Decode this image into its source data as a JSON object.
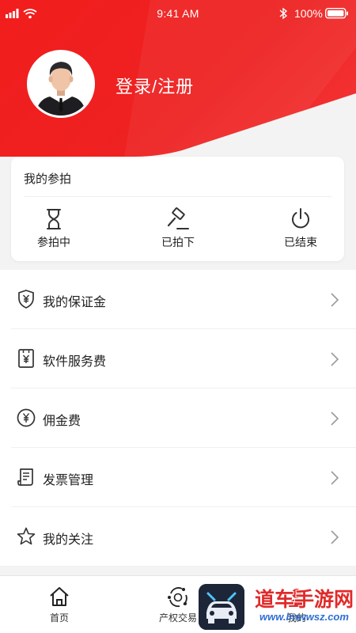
{
  "status_bar": {
    "time": "9:41 AM",
    "battery_percent": "100%"
  },
  "profile": {
    "login_label": "登录/注册"
  },
  "auction_card": {
    "title": "我的参拍",
    "items": [
      {
        "label": "参拍中",
        "icon": "hourglass-icon"
      },
      {
        "label": "已拍下",
        "icon": "gavel-icon"
      },
      {
        "label": "已结束",
        "icon": "power-icon"
      }
    ]
  },
  "menu": {
    "items": [
      {
        "label": "我的保证金",
        "icon": "shield-yuan-icon"
      },
      {
        "label": "软件服务费",
        "icon": "receipt-yuan-icon"
      },
      {
        "label": "佣金费",
        "icon": "yuan-circle-icon"
      },
      {
        "label": "发票管理",
        "icon": "invoice-icon"
      },
      {
        "label": "我的关注",
        "icon": "star-icon"
      }
    ]
  },
  "tabbar": {
    "items": [
      {
        "label": "首页",
        "icon": "home-icon"
      },
      {
        "label": "产权交易",
        "icon": "exchange-icon"
      },
      {
        "label": "我的",
        "icon": "user-icon"
      }
    ]
  },
  "watermark": {
    "name": "道车手游网",
    "url": "www.lmwwsz.com"
  },
  "colors": {
    "brand_red": "#f21d1d",
    "icon_dark": "#333333",
    "arrow_gray": "#9a9a9a"
  }
}
